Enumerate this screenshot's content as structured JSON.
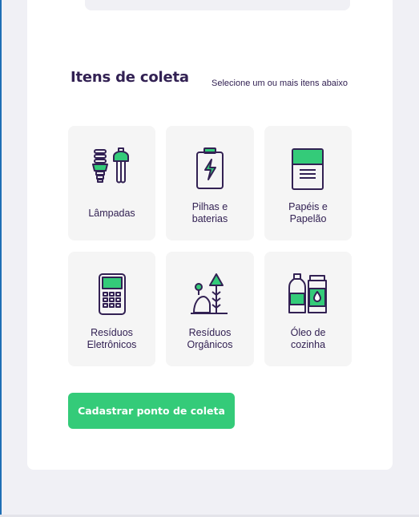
{
  "section": {
    "title": "Itens de coleta",
    "hint": "Selecione um ou mais itens abaixo"
  },
  "items": [
    {
      "label": "Lâmpadas",
      "icon": "lamp-icon"
    },
    {
      "label": "Pilhas e\nbaterias",
      "icon": "battery-icon"
    },
    {
      "label": "Papéis e\nPapelão",
      "icon": "paper-icon"
    },
    {
      "label": "Resíduos\nEletrônicos",
      "icon": "electronics-icon"
    },
    {
      "label": "Resíduos\nOrgânicos",
      "icon": "organic-icon"
    },
    {
      "label": "Óleo de\ncozinha",
      "icon": "oil-icon"
    }
  ],
  "actions": {
    "submit_label": "Cadastrar ponto de coleta"
  },
  "colors": {
    "accent": "#34cb79",
    "title": "#322153",
    "item_bg": "#f5f5f5"
  }
}
